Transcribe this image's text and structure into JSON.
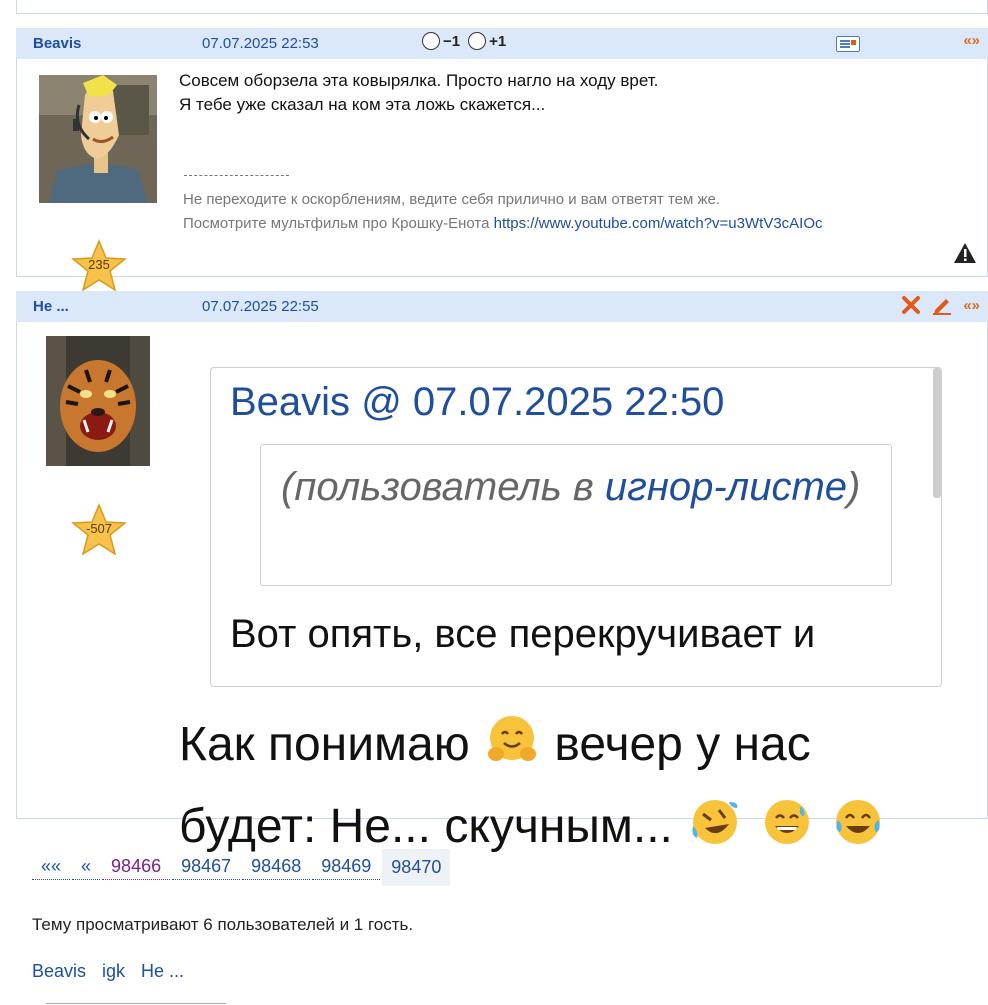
{
  "posts": [
    {
      "author": "Beavis",
      "date": "07.07.2025 22:53",
      "vote_minus": "−1",
      "vote_plus": "+1",
      "quote_glyph": "«»",
      "rating": "235",
      "message_lines": [
        "Совсем оборзела эта ковырялка. Просто нагло на ходу врет.",
        "Я тебе уже сказал на ком эта ложь скажется..."
      ],
      "signature_line1": "Не переходите к оскорблениям, ведите себя прилично и вам ответят тем же.",
      "signature_line2_text": "Посмотрите мультфильм про Крошку-Енота ",
      "signature_link": "https://www.youtube.com/watch?v=u3WtV3cAIOc"
    },
    {
      "author": "Не ...",
      "date": "07.07.2025 22:55",
      "quote_glyph": "«»",
      "rating": "-507",
      "quote_author": "Beavis",
      "quote_at": "@",
      "quote_date": "07.07.2025 22:50",
      "ignore_open": "(пользователь в ",
      "ignore_link": "игнор-листе",
      "ignore_close": ")",
      "quote_text": "Вот опять, все перекручивает и",
      "message_part1": "Как понимаю",
      "message_part2": "вечер у нас будет: Не... скучным..."
    }
  ],
  "pagination": {
    "first": "««",
    "prev": "«",
    "pages": [
      "98466",
      "98467",
      "98468",
      "98469"
    ],
    "current": "98470"
  },
  "viewers_text": "Тему просматривают 6 пользователей и 1 гость.",
  "viewers": [
    "Beavis",
    "igk",
    "Не ..."
  ],
  "colors": {
    "header_bg": "#dbe8fa",
    "link": "#1f4e9c",
    "accent": "#e06a1b"
  }
}
